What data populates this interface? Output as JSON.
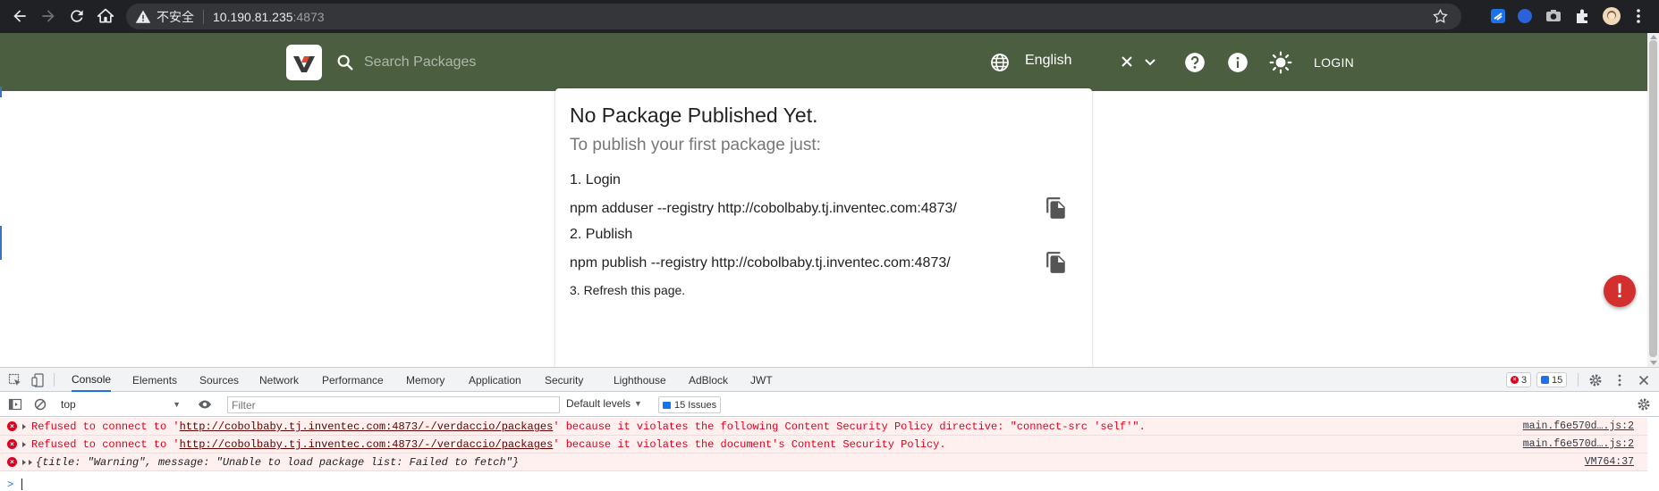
{
  "browser": {
    "security_label": "不安全",
    "url_host": "10.190.81.235",
    "url_port": ":4873"
  },
  "header": {
    "search_placeholder": "Search Packages",
    "language": "English",
    "login_label": "LOGIN"
  },
  "card": {
    "title": "No Package Published Yet.",
    "subtitle": "To publish your first package just:",
    "step1": "1. Login",
    "cmd1": "npm adduser --registry http://cobolbaby.tj.inventec.com:4873/",
    "step2": "2. Publish",
    "cmd2": "npm publish --registry http://cobolbaby.tj.inventec.com:4873/",
    "step3": "3. Refresh this page."
  },
  "fab": {
    "label": "!"
  },
  "devtools": {
    "tabs": [
      "Console",
      "Elements",
      "Sources",
      "Network",
      "Performance",
      "Memory",
      "Application",
      "Security",
      "Lighthouse",
      "AdBlock",
      "JWT"
    ],
    "active_tab": "Console",
    "error_count": "3",
    "issue_count": "15",
    "context": "top",
    "filter_placeholder": "Filter",
    "levels": "Default levels",
    "issues_label": "15 Issues",
    "messages": [
      {
        "pre": "Refused to connect to '",
        "link": "http://cobolbaby.tj.inventec.com:4873/-/verdaccio/packages",
        "post": "' because it violates the following Content Security Policy directive: \"connect-src 'self'\".",
        "source": "main.f6e570d….js:2"
      },
      {
        "pre": "Refused to connect to '",
        "link": "http://cobolbaby.tj.inventec.com:4873/-/verdaccio/packages",
        "post": "' because it violates the document's Content Security Policy.",
        "source": "main.f6e570d….js:2"
      },
      {
        "text": "{title: \"Warning\", message: \"Unable to load package list: Failed to fetch\"}",
        "source": "VM764:37"
      }
    ],
    "prompt": ">"
  },
  "colors": {
    "appbar": "#4b5e40",
    "error": "#e0001e",
    "accent": "#1a73e8"
  }
}
